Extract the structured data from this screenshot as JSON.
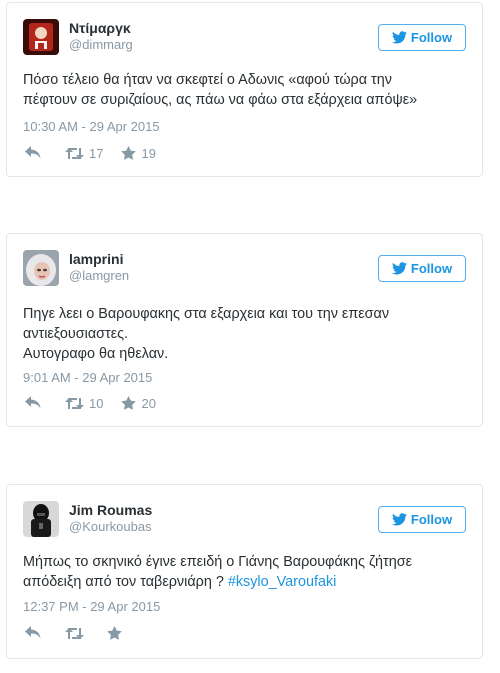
{
  "follow_label": "Follow",
  "accent_color": "#1b95e0",
  "tweets": [
    {
      "name": "Ντίμαργκ",
      "handle": "@dimmarg",
      "lines": [
        "Πόσο τέλειο θα ήταν να σκεφτεί ο Αδωνις «αφού τώρα την",
        "πέφτουν σε συριζαίους, ας πάω να φάω στα εξάρχεια απόψε»"
      ],
      "date": "10:30 AM - 29 Apr 2015",
      "retweets": "17",
      "favorites": "19"
    },
    {
      "name": "lamprini",
      "handle": "@lamgren",
      "lines": [
        "Πηγε λεει ο Βαρουφακης στα εξαρχεια και του την επεσαν",
        "αντιεξουσιαστες.",
        "Αυτογραφο θα ηθελαν."
      ],
      "date": "9:01 AM - 29 Apr 2015",
      "retweets": "10",
      "favorites": "20"
    },
    {
      "name": "Jim Roumas",
      "handle": "@Kourkoubas",
      "line1": "Μήπως το σκηνικό έγινε επειδή ο Γιάνης Βαρουφάκης ζήτησε",
      "line2_text": "απόδειξη από τον ταβερνιάρη ? ",
      "hashtag": "#ksylo_Varoufaki",
      "date": "12:37 PM - 29 Apr 2015",
      "retweets": "",
      "favorites": ""
    }
  ]
}
